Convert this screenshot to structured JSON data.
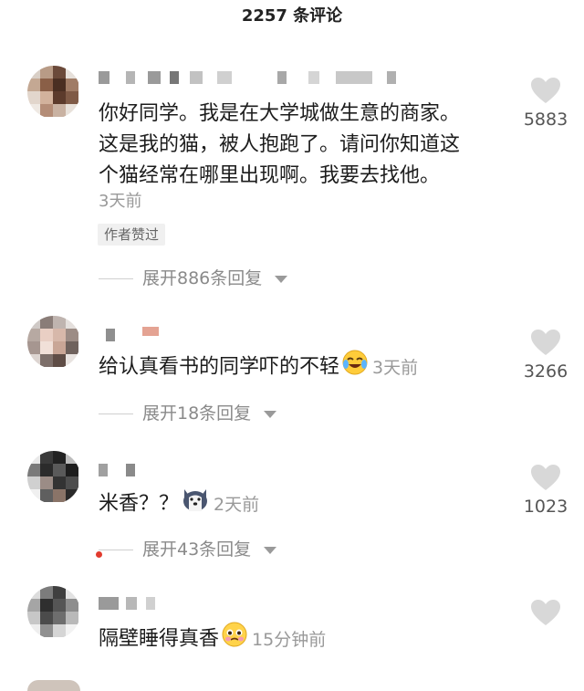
{
  "header": {
    "title": "2257 条评论"
  },
  "comments": [
    {
      "text": "你好同学。我是在大学城做生意的商家。\n这是我的猫，被人抱跑了。请问你知道这\n个猫经常在哪里出现啊。我要去找他。",
      "time": "3天前",
      "badge": "作者赞过",
      "replies_label": "展开886条回复",
      "likes": "5883"
    },
    {
      "text": "给认真看书的同学吓的不轻",
      "emoji": "crying-laughing-emoji",
      "time": "3天前",
      "replies_label": "展开18条回复",
      "likes": "3266"
    },
    {
      "text": "米香？？",
      "emoji": "husky-dog-emoji",
      "time": "2天前",
      "replies_label": "展开43条回复",
      "likes": "1023"
    },
    {
      "text": "隔壁睡得真香",
      "emoji": "pleading-face-emoji",
      "time": "15分钟前",
      "likes": ""
    }
  ],
  "colors": {
    "accent_red": "#e23b2e",
    "like_icon": "#d8d8d8",
    "meta_gray": "#999999"
  }
}
